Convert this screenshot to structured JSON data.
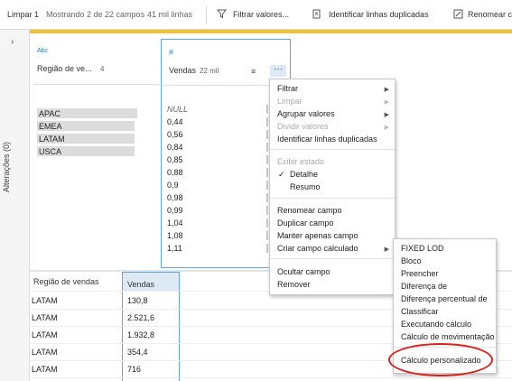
{
  "toolbar": {
    "step_name": "Limpar 1",
    "showing": "Mostrando 2 de 22 campos",
    "rows": "41 mil linhas",
    "filter_label": "Filtrar valores...",
    "duplicates_label": "Identificar linhas duplicadas",
    "rename_label": "Renomear c",
    "accent_color": "#f2c12e"
  },
  "rail": {
    "label": "Alterações (0)",
    "chevron": "›"
  },
  "profile": {
    "regiao": {
      "type_badge": "Abc",
      "title": "Região de ve...",
      "count": "4",
      "values": [
        {
          "label": "APAC",
          "fill": 0.96
        },
        {
          "label": "EMEA",
          "fill": 0.93
        },
        {
          "label": "LATAM",
          "fill": 0.93
        },
        {
          "label": "USCA",
          "fill": 0.93
        }
      ]
    },
    "vendas": {
      "type_badge": "#",
      "title": "Vendas",
      "count": "22 mil",
      "sort_icon": "≡",
      "menu_icon": "···",
      "values": [
        "NULL",
        "0,44",
        "0,56",
        "0,84",
        "0,85",
        "0,88",
        "0,9",
        "0,98",
        "0,99",
        "1,04",
        "1,08",
        "1,11"
      ]
    }
  },
  "grid": {
    "headers": [
      "Região de vendas",
      "Vendas"
    ],
    "rows": [
      [
        "LATAM",
        "130,8"
      ],
      [
        "LATAM",
        "2.521,6"
      ],
      [
        "LATAM",
        "1.932,8"
      ],
      [
        "LATAM",
        "354,4"
      ],
      [
        "LATAM",
        "716"
      ],
      [
        "LATAM",
        "561,2"
      ]
    ]
  },
  "menu": {
    "items": [
      {
        "label": "Filtrar",
        "disabled": false,
        "submenu": true
      },
      {
        "label": "Limpar",
        "disabled": true,
        "submenu": true
      },
      {
        "label": "Agrupar valores",
        "disabled": false,
        "submenu": true
      },
      {
        "label": "Dividir valores",
        "disabled": true,
        "submenu": true
      },
      {
        "label": "Identificar linhas duplicadas",
        "disabled": false,
        "submenu": false
      },
      {
        "label": "Exibir estado",
        "disabled": true,
        "submenu": false
      },
      {
        "label": "Detalhe",
        "disabled": false,
        "submenu": false,
        "checked": true
      },
      {
        "label": "Resumo",
        "disabled": false,
        "submenu": false
      },
      {
        "label": "Renomear campo",
        "disabled": false,
        "submenu": false
      },
      {
        "label": "Duplicar campo",
        "disabled": false,
        "submenu": false
      },
      {
        "label": "Manter apenas campo",
        "disabled": false,
        "submenu": false
      },
      {
        "label": "Criar campo calculado",
        "disabled": false,
        "submenu": true
      },
      {
        "label": "Ocultar campo",
        "disabled": false,
        "submenu": false
      },
      {
        "label": "Remover",
        "disabled": false,
        "submenu": false
      }
    ],
    "check_mark": "✓",
    "arrow": "▶"
  },
  "submenu": {
    "items": [
      "FIXED LOD",
      "Bloco",
      "Preencher",
      "Diferença de",
      "Diferença percentual de",
      "Classificar",
      "Executando cálculo",
      "Cálculo de movimentação",
      "Cálculo personalizado"
    ],
    "highlight_color": "#d9211a"
  }
}
